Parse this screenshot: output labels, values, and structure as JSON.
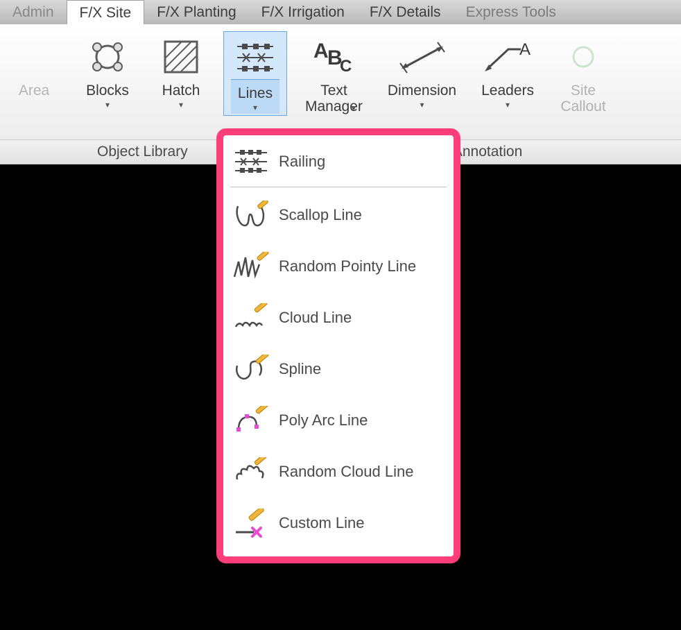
{
  "tabs": {
    "admin": "Admin",
    "site": "F/X Site",
    "planting": "F/X Planting",
    "irrigation": "F/X Irrigation",
    "details": "F/X Details",
    "express": "Express Tools"
  },
  "ribbon": {
    "area": "Area",
    "blocks": "Blocks",
    "hatch": "Hatch",
    "lines": "Lines",
    "text_manager": "Text\nManager",
    "dimension": "Dimension",
    "leaders": "Leaders",
    "site_callout": "Site\nCallout"
  },
  "panels": {
    "object_library": "Object Library",
    "site_annotation": "Site Annotation"
  },
  "dropdown": {
    "railing": "Railing",
    "scallop": "Scallop Line",
    "random_pointy": "Random Pointy Line",
    "cloud": "Cloud Line",
    "spline": "Spline",
    "poly_arc": "Poly Arc Line",
    "random_cloud": "Random Cloud Line",
    "custom": "Custom Line"
  }
}
